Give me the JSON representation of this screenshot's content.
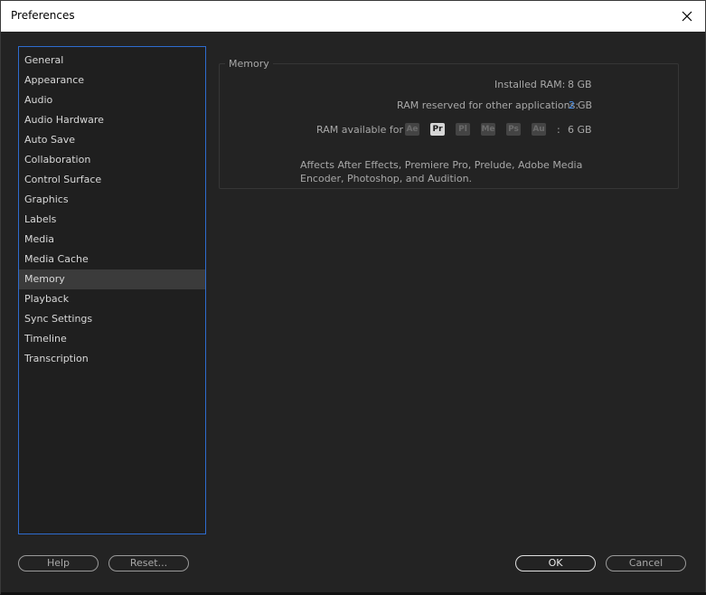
{
  "window": {
    "title": "Preferences"
  },
  "sidebar": {
    "items": [
      {
        "label": "General"
      },
      {
        "label": "Appearance"
      },
      {
        "label": "Audio"
      },
      {
        "label": "Audio Hardware"
      },
      {
        "label": "Auto Save"
      },
      {
        "label": "Collaboration"
      },
      {
        "label": "Control Surface"
      },
      {
        "label": "Graphics"
      },
      {
        "label": "Labels"
      },
      {
        "label": "Media"
      },
      {
        "label": "Media Cache"
      },
      {
        "label": "Memory",
        "selected": true
      },
      {
        "label": "Playback"
      },
      {
        "label": "Sync Settings"
      },
      {
        "label": "Timeline"
      },
      {
        "label": "Transcription"
      }
    ]
  },
  "memory": {
    "group_title": "Memory",
    "installed_ram_label": "Installed RAM:",
    "installed_ram_value": "8 GB",
    "reserved_label": "RAM reserved for other applications:",
    "reserved_value": "2",
    "reserved_unit": "GB",
    "available_label": "RAM available for",
    "apps": [
      {
        "abbr": "Ae",
        "active": false
      },
      {
        "abbr": "Pr",
        "active": true
      },
      {
        "abbr": "Pl",
        "active": false
      },
      {
        "abbr": "Me",
        "active": false
      },
      {
        "abbr": "Ps",
        "active": false
      },
      {
        "abbr": "Au",
        "active": false
      }
    ],
    "available_separator": ":",
    "available_value": "6 GB",
    "note": "Affects After Effects, Premiere Pro, Prelude, Adobe Media Encoder, Photoshop, and Audition."
  },
  "buttons": {
    "help": "Help",
    "reset": "Reset...",
    "ok": "OK",
    "cancel": "Cancel"
  },
  "colors": {
    "accent": "#2e6ccf",
    "value_blue": "#4a8fe7",
    "background": "#232323"
  }
}
